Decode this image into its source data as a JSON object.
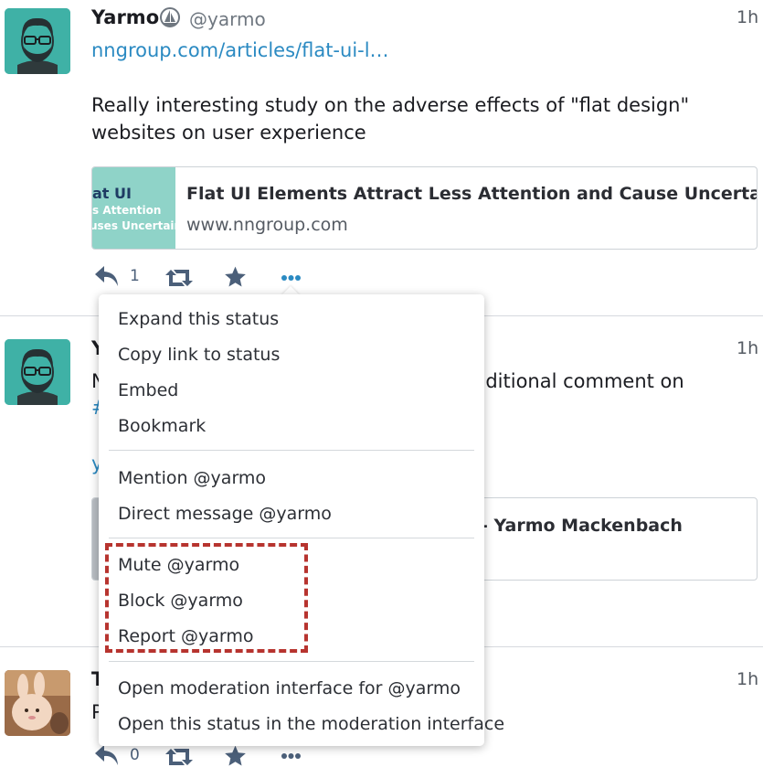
{
  "posts": [
    {
      "display_name": "Yarmo",
      "handle": "@yarmo",
      "time": "1h",
      "link": "nngroup.com/articles/flat-ui-l…",
      "text": "Really interesting study on the adverse effects of \"flat design\" websites on user experience",
      "card": {
        "thumb_line1": "at UI",
        "thumb_line2": "s Attention",
        "thumb_line3": "uses Uncertainty",
        "title": "Flat UI Elements Attract Less Attention and Cause Uncertainty",
        "url": "www.nngroup.com"
      },
      "reply_count": "1"
    },
    {
      "display_name": "Y",
      "time": "1h",
      "text_start": "N",
      "text_end": "dditional comment on",
      "hashtag_start": "#",
      "link_start": "y",
      "card_title_fragment": "- Yarmo Mackenbach"
    },
    {
      "display_name": "T",
      "time": "1h",
      "text_start": "P",
      "reply_count": "0"
    }
  ],
  "menu": {
    "items": [
      "Expand this status",
      "Copy link to status",
      "Embed",
      "Bookmark",
      "Mention @yarmo",
      "Direct message @yarmo",
      "Mute @yarmo",
      "Block @yarmo",
      "Report @yarmo",
      "Open moderation interface for @yarmo",
      "Open this status in the moderation interface"
    ]
  },
  "colors": {
    "accent": "#2b8ac2",
    "avatar_bg": "#3fb1a6",
    "highlight": "#b7342f",
    "icon": "#4b5f79"
  },
  "icons": [
    "reply-icon",
    "boost-icon",
    "star-icon",
    "more-icon",
    "bot-badge-icon"
  ]
}
